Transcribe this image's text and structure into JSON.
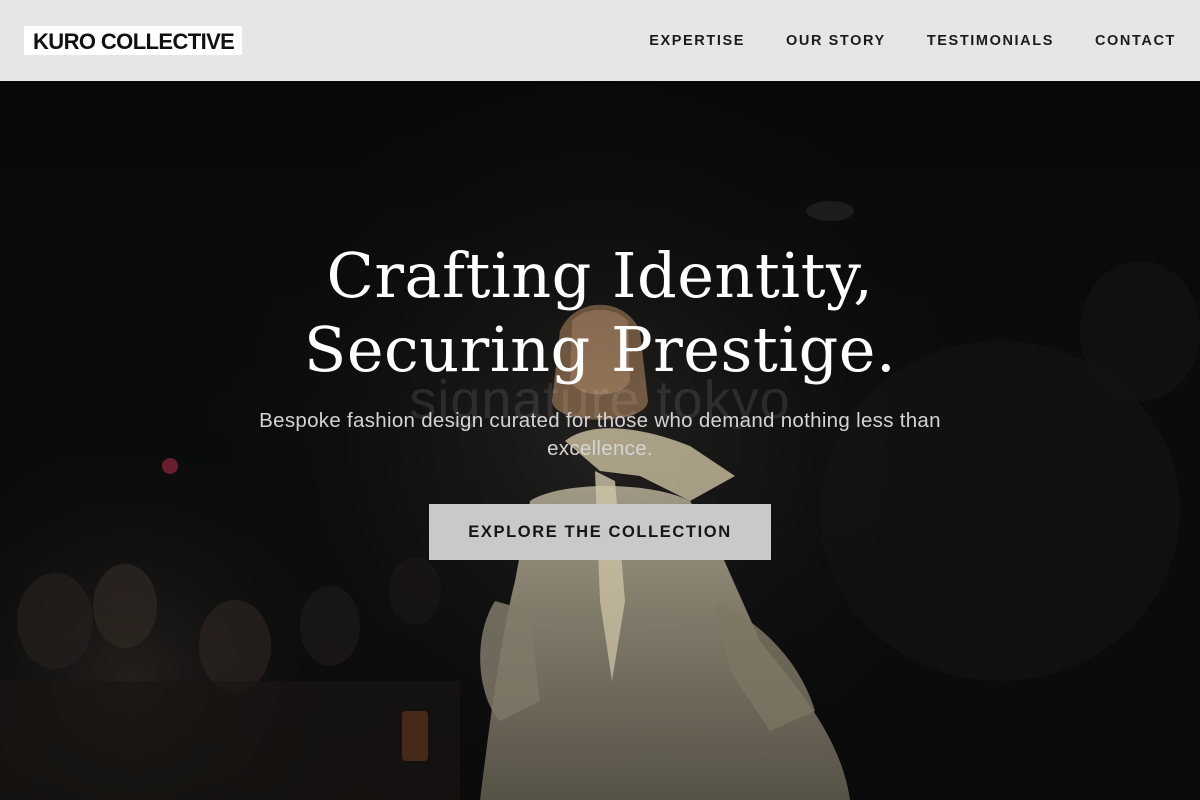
{
  "header": {
    "logo": "KURO COLLECTIVE",
    "nav": [
      {
        "label": "EXPERTISE"
      },
      {
        "label": "OUR STORY"
      },
      {
        "label": "TESTIMONIALS"
      },
      {
        "label": "CONTACT"
      }
    ]
  },
  "hero": {
    "headline_line1": "Crafting Identity,",
    "headline_line2": "Securing Prestige.",
    "subheading": "Bespoke fashion design curated for those who demand nothing less than excellence.",
    "cta_label": "EXPLORE THE COLLECTION",
    "background_image": "runway-model-photo",
    "watermark": "signature tokyo"
  },
  "colors": {
    "header_bg": "#e6e6e6",
    "logo_bg": "#ffffff",
    "hero_bg": "#0b0c0d",
    "cta_bg": "#c9c9c9",
    "headline": "#ffffff"
  }
}
